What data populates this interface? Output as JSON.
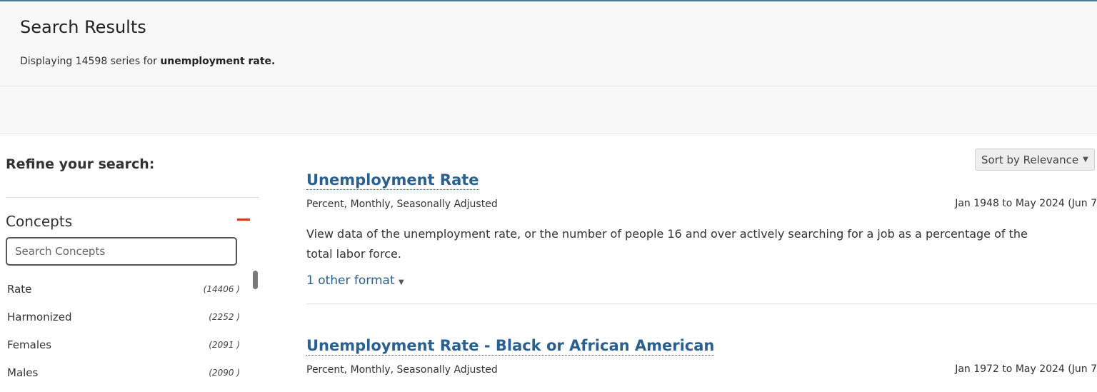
{
  "header": {
    "title": "Search Results",
    "summary_prefix": "Displaying 14598 series for",
    "query": "unemployment rate."
  },
  "sidebar": {
    "refine_heading": "Refine your search:",
    "concepts_title": "Concepts",
    "search_placeholder": "Search Concepts",
    "items": [
      {
        "label": "Rate",
        "count": "(14406 )"
      },
      {
        "label": "Harmonized",
        "count": "(2252 )"
      },
      {
        "label": "Females",
        "count": "(2091 )"
      },
      {
        "label": "Males",
        "count": "(2090 )"
      }
    ]
  },
  "sort": {
    "label": "Sort by Relevance"
  },
  "results": [
    {
      "title": "Unemployment Rate",
      "meta": "Percent, Monthly, Seasonally Adjusted",
      "range": "Jan 1948 to May 2024 (Jun 7",
      "description": "View data of the unemployment rate, or the number of people 16 and over actively searching for a job as a percentage of the total labor force.",
      "formats": "1 other format"
    },
    {
      "title": "Unemployment Rate - Black or African American",
      "meta": "Percent, Monthly, Seasonally Adjusted",
      "range": "Jan 1972 to May 2024 (Jun 7"
    }
  ],
  "colors": {
    "link": "#2a5f8f",
    "accent_red": "#d9381e",
    "band": "#f8f8f8"
  }
}
